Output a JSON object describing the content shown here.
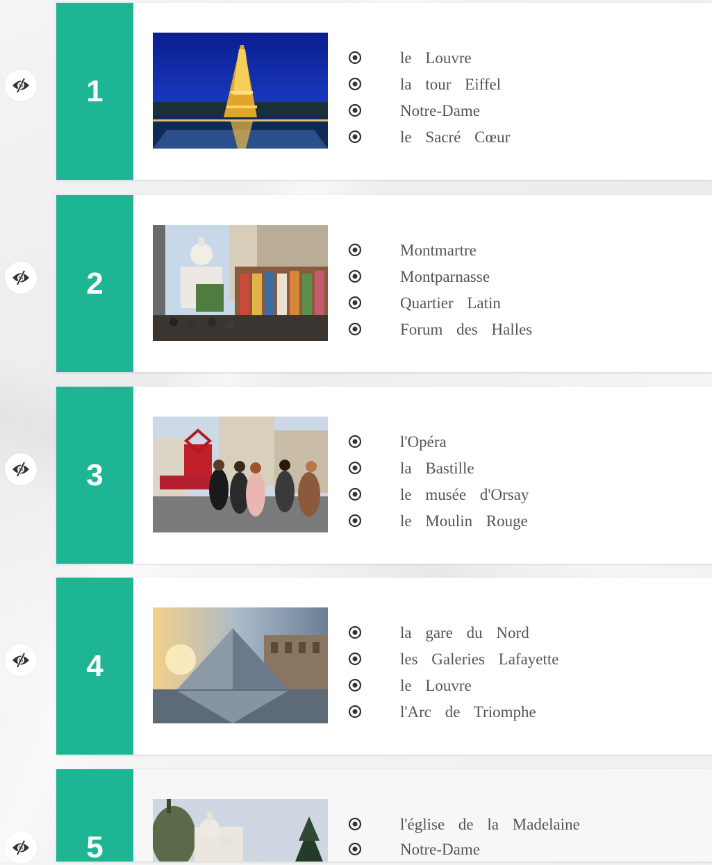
{
  "items": [
    {
      "number": "1",
      "places": [
        "le Louvre",
        "la tour Eiffel",
        "Notre-Dame",
        "le Sacré Cœur"
      ]
    },
    {
      "number": "2",
      "places": [
        "Montmartre",
        "Montparnasse",
        "Quartier Latin",
        "Forum des Halles"
      ]
    },
    {
      "number": "3",
      "places": [
        "l'Opéra",
        "la Bastille",
        "le musée d'Orsay",
        "le Moulin Rouge"
      ]
    },
    {
      "number": "4",
      "places": [
        "la gare du Nord",
        "les Galeries Lafayette",
        "le Louvre",
        "l'Arc de Triomphe"
      ]
    },
    {
      "number": "5",
      "places": [
        "l'église de la Madelaine",
        "Notre-Dame"
      ]
    }
  ],
  "colors": {
    "accent": "#1db594",
    "text": "#555555",
    "icon": "#333333"
  },
  "icons": {
    "toggle": "eye-slash-icon",
    "bullet": "radio-dot-icon"
  }
}
